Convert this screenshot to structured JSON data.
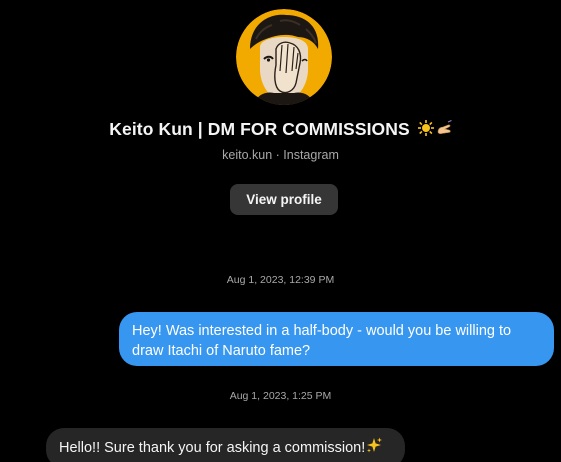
{
  "profile": {
    "name": "Keito Kun | DM FOR COMMISSIONS",
    "name_emojis": "🌞✍",
    "handle_line": "keito.kun · Instagram",
    "view_profile_label": "View profile",
    "avatar_icon": "profile-avatar-illustration"
  },
  "messages": [
    {
      "timestamp": "Aug 1, 2023, 12:39 PM",
      "direction": "outgoing",
      "text": "Hey! Was interested in a half-body - would you be willing to draw Itachi of Naruto fame?"
    },
    {
      "timestamp": "Aug 1, 2023, 1:25 PM",
      "direction": "incoming",
      "text": "Hello!! Sure thank you for asking a commission!",
      "emoji": "✨"
    }
  ],
  "colors": {
    "background": "#000000",
    "outgoing_bubble": "#3797f0",
    "incoming_bubble": "#262626",
    "button": "#363636",
    "secondary_text": "#a8a8a8",
    "avatar_ring": "#f2a900"
  }
}
